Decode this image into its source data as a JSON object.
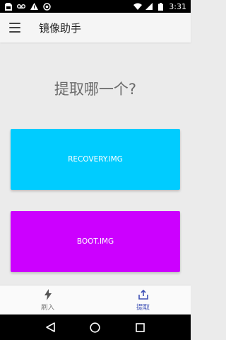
{
  "status_bar": {
    "time": "3:31",
    "left_icons": [
      "sim-card-icon",
      "voicemail-icon",
      "warning-icon",
      "sync-icon"
    ],
    "right_icons": [
      "wifi-icon",
      "signal-icon",
      "battery-icon"
    ]
  },
  "app_bar": {
    "title": "镜像助手",
    "menu_icon": "hamburger-menu-icon"
  },
  "main": {
    "prompt": "提取哪一个?",
    "buttons": [
      {
        "label": "RECOVERY.IMG",
        "color": "#00ccff"
      },
      {
        "label": "BOOT.IMG",
        "color": "#cc00ff"
      }
    ]
  },
  "bottom_nav": {
    "items": [
      {
        "label": "刷入",
        "icon": "flash-icon",
        "active": false
      },
      {
        "label": "提取",
        "icon": "extract-icon",
        "active": true
      }
    ],
    "active_color": "#3f51b5"
  },
  "system_nav": {
    "icons": [
      "back-icon",
      "home-icon",
      "recents-icon"
    ]
  }
}
